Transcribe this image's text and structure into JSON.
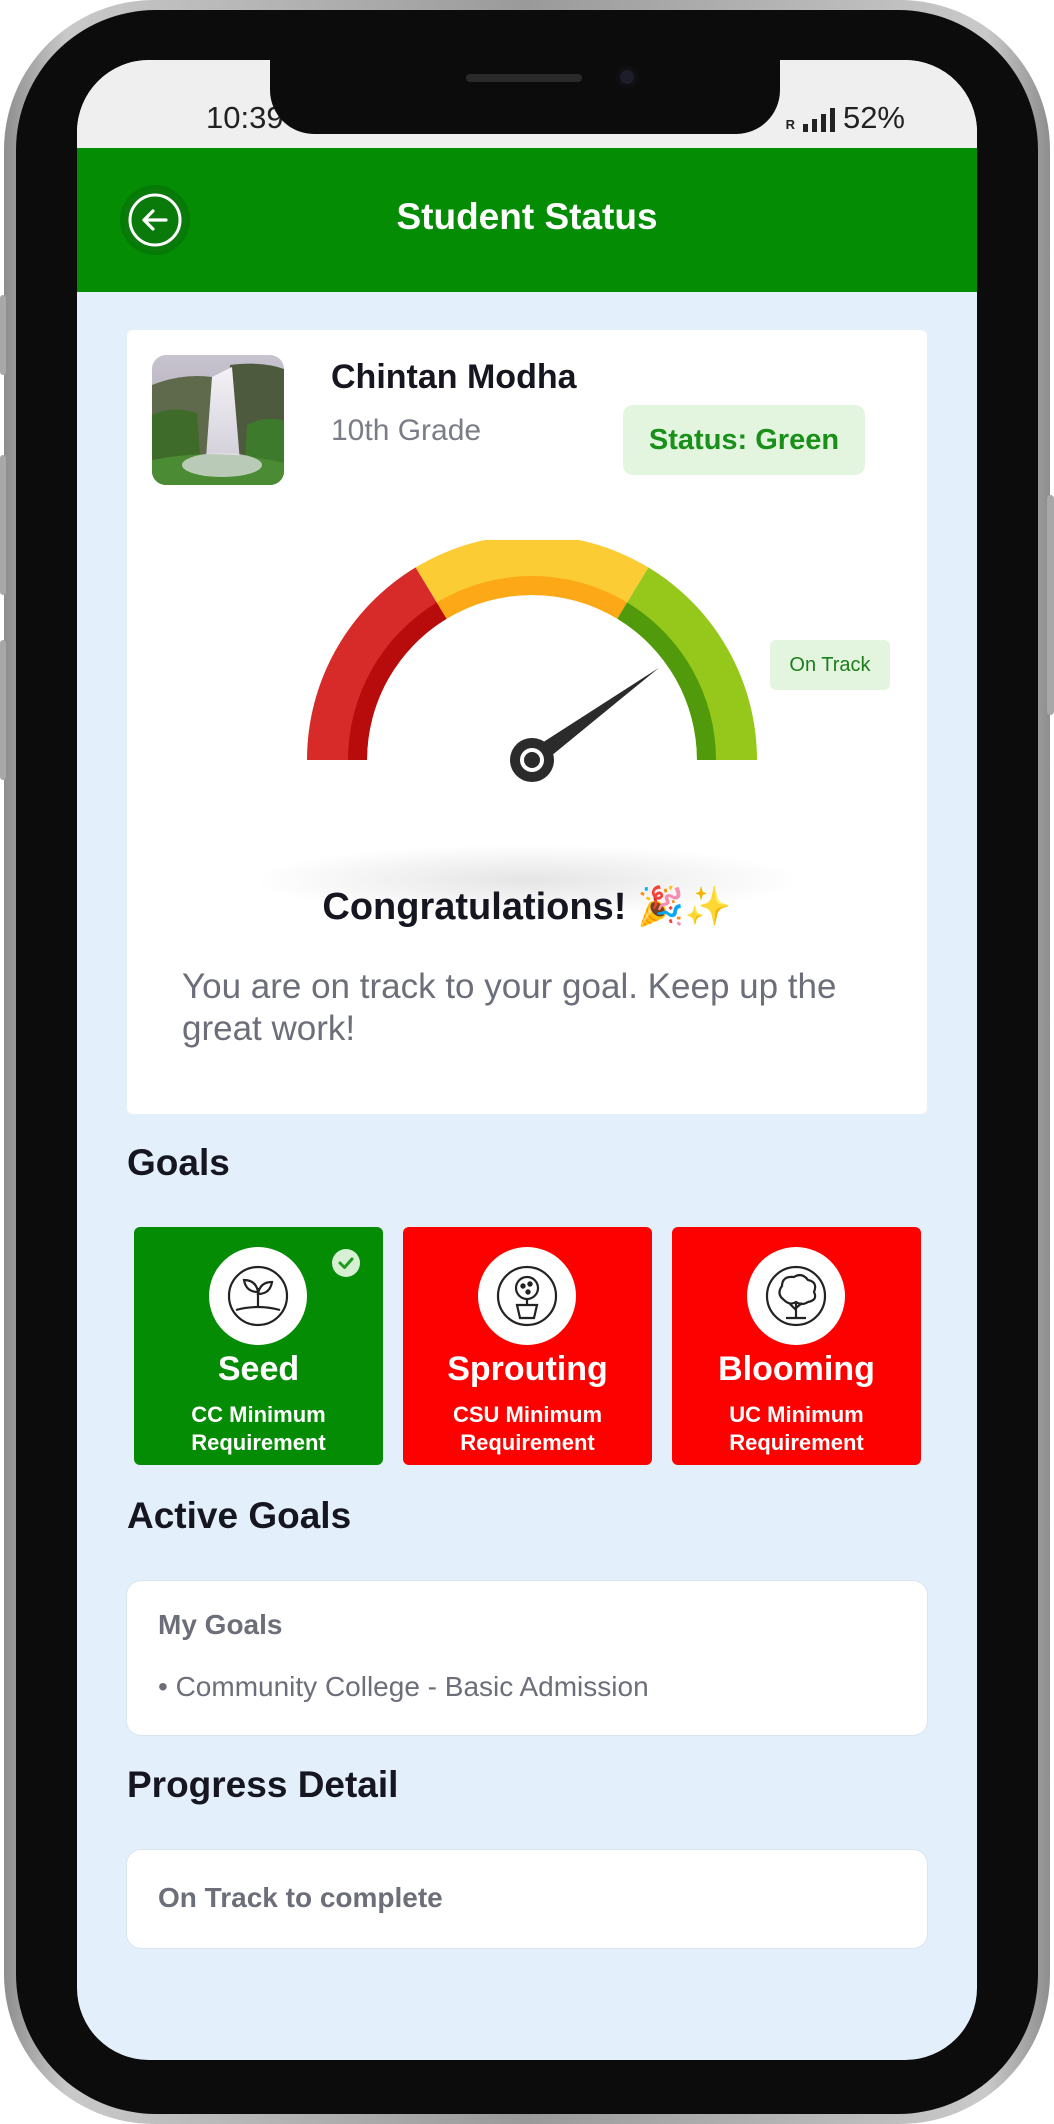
{
  "status_bar": {
    "time": "10:39",
    "network_label": "R",
    "battery": "52%"
  },
  "header": {
    "title": "Student Status"
  },
  "student": {
    "name": "Chintan Modha",
    "grade": "10th Grade",
    "status_label": "Status: Green",
    "status_color": "#18901a"
  },
  "gauge": {
    "badge": "On Track",
    "level": 0.8,
    "segments": [
      {
        "color": "#d62b28"
      },
      {
        "color": "#fccc34"
      },
      {
        "color": "#96c81c"
      }
    ]
  },
  "message": {
    "title": "Congratulations! 🎉✨",
    "body": "You are on track to your goal. Keep up the great work!"
  },
  "goals": {
    "title": "Goals",
    "items": [
      {
        "name": "Seed",
        "sub": "CC Minimum Requirement",
        "icon": "seedling-icon",
        "color": "#058c05",
        "achieved": true
      },
      {
        "name": "Sprouting",
        "sub": "CSU Minimum Requirement",
        "icon": "potted-plant-icon",
        "color": "#fd0000",
        "achieved": false
      },
      {
        "name": "Blooming",
        "sub": "UC Minimum Requirement",
        "icon": "tree-icon",
        "color": "#fd0000",
        "achieved": false
      }
    ]
  },
  "active_goals": {
    "title": "Active Goals",
    "card_label": "My Goals",
    "items": [
      "• Community College - Basic Admission"
    ]
  },
  "progress": {
    "title": "Progress Detail",
    "text": "On Track to complete"
  },
  "colors": {
    "brand_green": "#058c05",
    "background": "#e3f0fb"
  }
}
